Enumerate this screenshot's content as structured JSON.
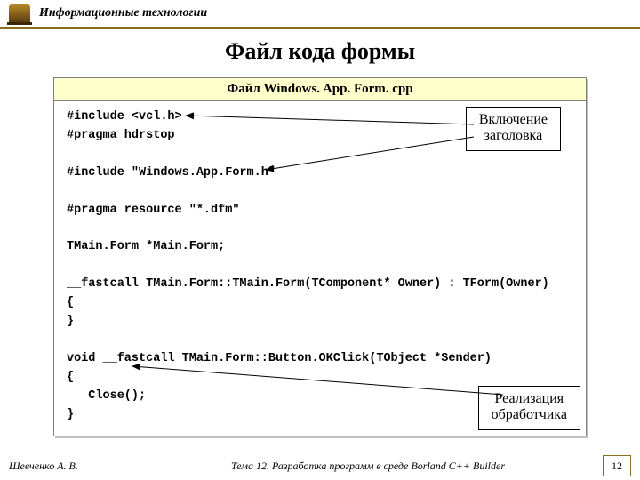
{
  "header": {
    "course": "Информационные технологии"
  },
  "title": "Файл кода формы",
  "panel": {
    "caption": "Файл Windows. App. Form. cpp",
    "code": "#include <vcl.h>\n#pragma hdrstop\n\n#include \"Windows.App.Form.h\"\n\n#pragma resource \"*.dfm\"\n\nTMain.Form *Main.Form;\n\n__fastcall TMain.Form::TMain.Form(TComponent* Owner) : TForm(Owner)\n{\n}\n\nvoid __fastcall TMain.Form::Button.OKClick(TObject *Sender)\n{\n   Close();\n}"
  },
  "callouts": {
    "c1_line1": "Включение",
    "c1_line2": "заголовка",
    "c2_line1": "Реализация",
    "c2_line2": "обработчика"
  },
  "footer": {
    "author": "Шевченко А. В.",
    "topic": "Тема 12. Разработка программ в среде Borland C++ Builder",
    "page": "12"
  }
}
